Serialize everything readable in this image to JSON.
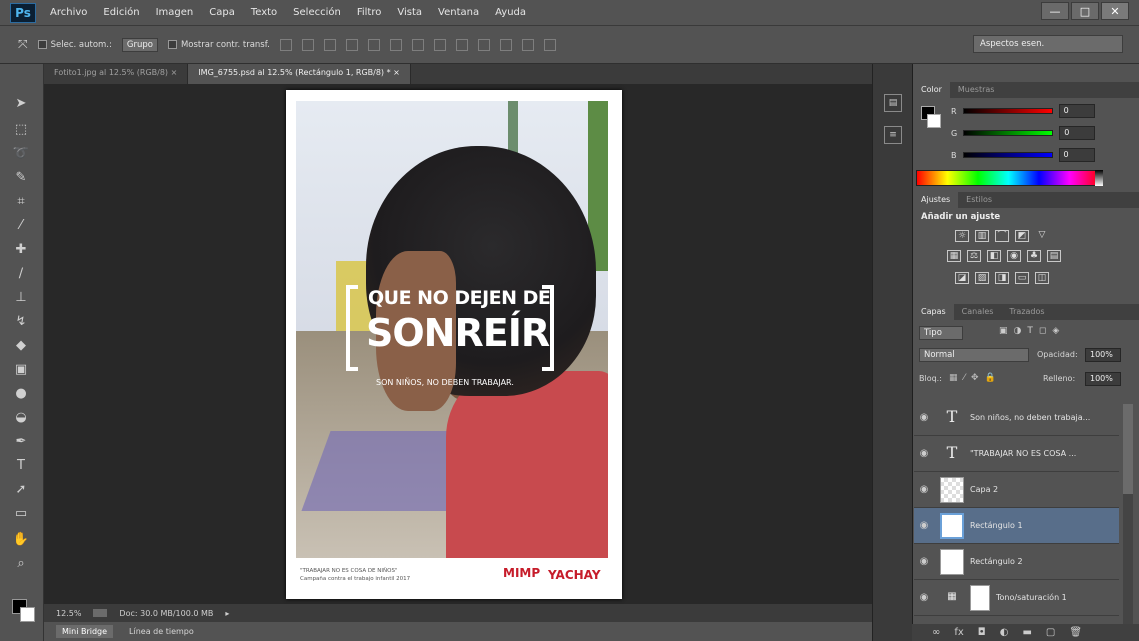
{
  "app": {
    "logo": "Ps"
  },
  "menu": [
    "Archivo",
    "Edición",
    "Imagen",
    "Capa",
    "Texto",
    "Selección",
    "Filtro",
    "Vista",
    "Ventana",
    "Ayuda"
  ],
  "window_controls": {
    "minimize": "—",
    "maximize": "□",
    "close": "✕"
  },
  "options": {
    "auto_select": "Selec. autom.:",
    "group": "Grupo",
    "show_transform": "Mostrar contr. transf.",
    "workspace": "Aspectos esen."
  },
  "tabs": [
    {
      "label": "Fotito1.jpg al 12.5% (RGB/8) ×"
    },
    {
      "label": "IMG_6755.psd al 12.5% (Rectángulo 1, RGB/8) * ×"
    }
  ],
  "poster": {
    "headline_line1": "QUE NO DEJEN DE",
    "headline_line2": "SONREÍR",
    "headline_line3": "SON NIÑOS, NO DEBEN TRABAJAR.",
    "footer_line1": "\"TRABAJAR NO ES COSA DE NIÑOS\"",
    "footer_line2": "Campaña contra el trabajo infantil 2017",
    "logo_left": "MIMP",
    "logo_right": "YACHAY"
  },
  "status": {
    "zoom": "12.5%",
    "doc": "Doc: 30.0 MB/100.0 MB"
  },
  "bottom_tabs": [
    {
      "label": "Mini Bridge"
    },
    {
      "label": "Línea de tiempo"
    }
  ],
  "color_panel": {
    "tabs": [
      "Color",
      "Muestras"
    ],
    "r_label": "R",
    "g_label": "G",
    "b_label": "B",
    "r": "0",
    "g": "0",
    "b": "0"
  },
  "adjust_panel": {
    "tabs": [
      "Ajustes",
      "Estilos"
    ],
    "title": "Añadir un ajuste"
  },
  "layers_panel": {
    "tabs": [
      "Capas",
      "Canales",
      "Trazados"
    ],
    "kind": "Tipo",
    "blend_mode": "Normal",
    "opacity_label": "Opacidad:",
    "opacity": "100%",
    "lock_label": "Bloq.:",
    "fill_label": "Relleno:",
    "fill": "100%",
    "layers": [
      {
        "name": "Son niños, no deben trabaja...",
        "type": "text"
      },
      {
        "name": "\"TRABAJAR NO ES COSA ...",
        "type": "text"
      },
      {
        "name": "Capa 2",
        "type": "pixel"
      },
      {
        "name": "Rectángulo 1",
        "type": "shape",
        "selected": true
      },
      {
        "name": "Rectángulo 2",
        "type": "shape"
      },
      {
        "name": "Tono/saturación 1",
        "type": "adjustment"
      }
    ]
  },
  "colors": {
    "accent_selected": "#586e8a",
    "brand_red": "#c61c2a"
  }
}
